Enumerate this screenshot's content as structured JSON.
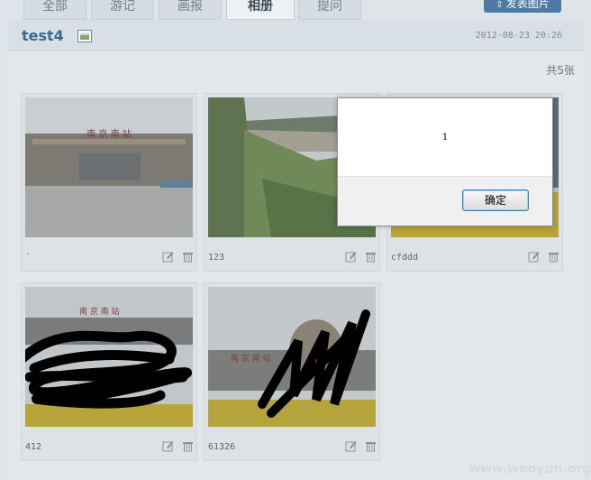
{
  "tabs": [
    {
      "label": "全部"
    },
    {
      "label": "游记"
    },
    {
      "label": "画报"
    },
    {
      "label": "相册",
      "active": true
    },
    {
      "label": "提问"
    }
  ],
  "upload_button": {
    "label": "发表图片"
  },
  "album": {
    "title": "test4",
    "datetime": "2012-08-23 20:26",
    "count": "共5张"
  },
  "photos": [
    {
      "caption": "´"
    },
    {
      "caption": "123"
    },
    {
      "caption": "cfddd"
    },
    {
      "caption": "412"
    },
    {
      "caption": "61326"
    }
  ],
  "dialog": {
    "message": "1",
    "ok_label": "确定"
  },
  "watermark": "www.wooyun.org"
}
